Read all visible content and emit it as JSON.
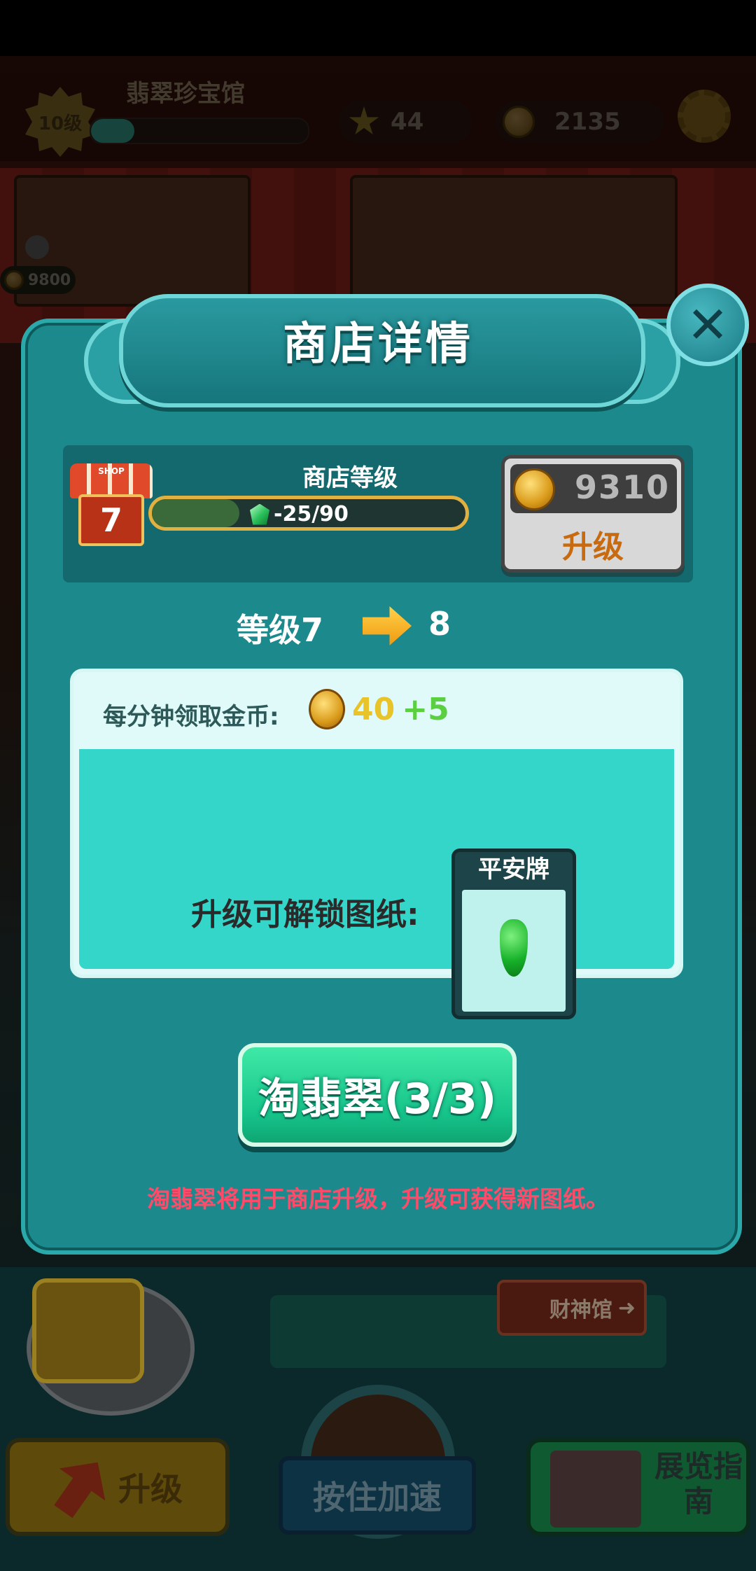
{
  "hud": {
    "level_badge": "10级",
    "hall_title": "翡翠珍宝馆",
    "xp_progress": 0.2,
    "stars": "44",
    "coins": "2135",
    "settings_icon": "gear-icon"
  },
  "background": {
    "locked_price": "9800",
    "fortune_hall_sign": "财神馆"
  },
  "modal": {
    "title": "商店详情",
    "close_icon": "close-icon",
    "shop": {
      "badge_text": "SHOP",
      "level": "7",
      "level_label": "商店等级",
      "progress_text": "-25/90",
      "progress_value": 0.28,
      "upgrade_cost": "9310",
      "upgrade_button": "升级"
    },
    "level_change": {
      "from": "等级7",
      "to": "8"
    },
    "reward": {
      "rate_label": "每分钟领取金币:",
      "rate_base": "40",
      "rate_bonus": "+5",
      "unlock_label": "升级可解锁图纸:",
      "blueprint_name": "平安牌"
    },
    "action_button": "淘翡翠(3/3)",
    "hint": "淘翡翠将用于商店升级，升级可获得新图纸。"
  },
  "bottom": {
    "upgrade_button": "升级",
    "hold_button": "按住加速",
    "guide_button": "展览指南"
  },
  "colors": {
    "modal_teal": "#1c8a8c",
    "accent_green": "#16c48a",
    "hint_red": "#ff4b6a",
    "coin_gold": "#d99a1a"
  }
}
